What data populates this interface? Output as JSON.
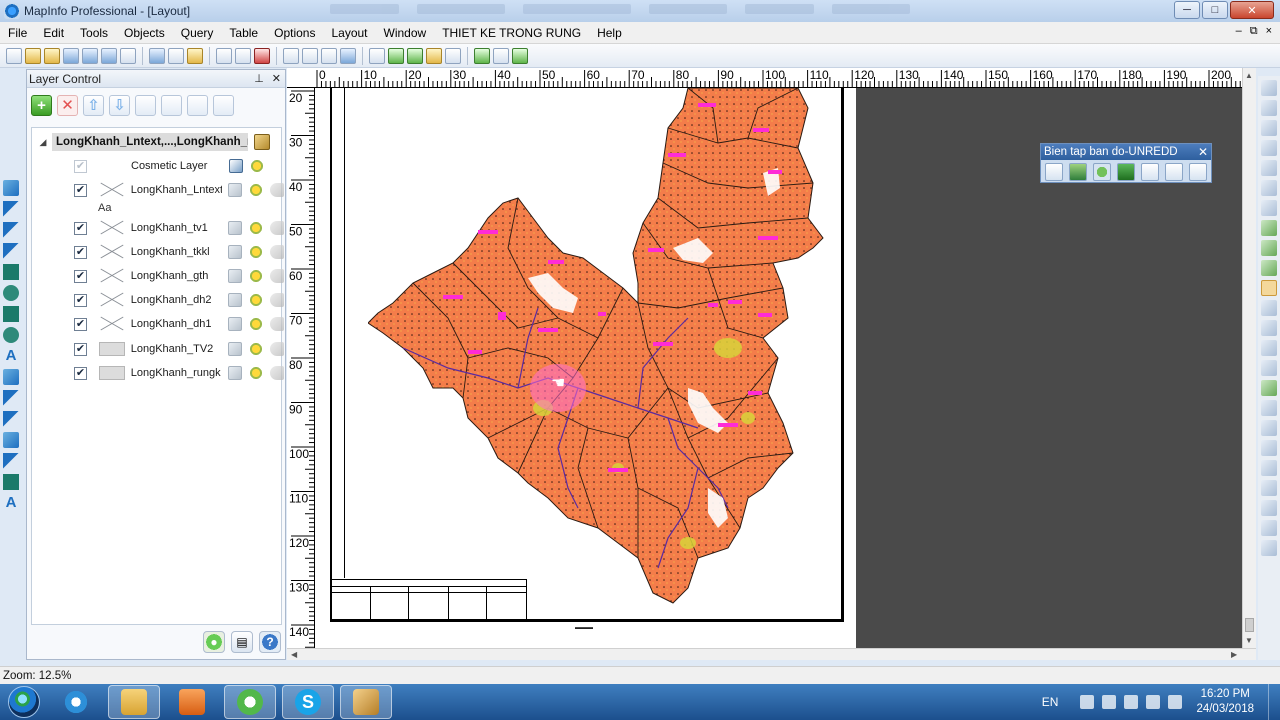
{
  "window": {
    "title": "MapInfo Professional - [Layout]",
    "controls": {
      "minimize": "─",
      "maximize": "□",
      "close": "✕"
    },
    "mdi_controls": {
      "minimize": "–",
      "restore": "⧉",
      "close": "×"
    }
  },
  "menu": [
    "File",
    "Edit",
    "Tools",
    "Objects",
    "Query",
    "Table",
    "Options",
    "Layout",
    "Window",
    "THIET KE TRONG RUNG",
    "Help"
  ],
  "layer_control": {
    "title": "Layer Control",
    "pin": "⊥",
    "close": "✕",
    "root_label": "LongKhanh_Lntext,...,LongKhanh_ru",
    "expand_glyph": "◢",
    "layers": [
      {
        "name": "Cosmetic Layer",
        "checked": true,
        "dimmed": true,
        "symbol": "none"
      },
      {
        "name": "LongKhanh_Lntext",
        "checked": true,
        "dimmed": false,
        "symbol": "x",
        "sub": "Aa"
      },
      {
        "name": "LongKhanh_tv1",
        "checked": true,
        "dimmed": false,
        "symbol": "x"
      },
      {
        "name": "LongKhanh_tkkl",
        "checked": true,
        "dimmed": false,
        "symbol": "x"
      },
      {
        "name": "LongKhanh_gth",
        "checked": true,
        "dimmed": false,
        "symbol": "x"
      },
      {
        "name": "LongKhanh_dh2",
        "checked": true,
        "dimmed": false,
        "symbol": "x"
      },
      {
        "name": "LongKhanh_dh1",
        "checked": true,
        "dimmed": false,
        "symbol": "x"
      },
      {
        "name": "LongKhanh_TV2",
        "checked": true,
        "dimmed": false,
        "symbol": "box"
      },
      {
        "name": "LongKhanh_rungk",
        "checked": true,
        "dimmed": false,
        "symbol": "box"
      }
    ],
    "check_glyph": "✔",
    "tools": {
      "add": "+",
      "remove": "✕"
    },
    "bottom": {
      "ok": "●",
      "options": "▤",
      "help": "?"
    }
  },
  "ruler": {
    "top": [
      "0",
      "10",
      "20",
      "30",
      "40",
      "50",
      "60",
      "70",
      "80",
      "90",
      "100",
      "110",
      "120",
      "130",
      "140",
      "150",
      "160",
      "170",
      "180",
      "190",
      "200"
    ],
    "left": [
      "20",
      "30",
      "40",
      "50",
      "60",
      "70",
      "80",
      "90",
      "100",
      "110",
      "120",
      "130",
      "140"
    ]
  },
  "floating_toolbar": {
    "title": "Bien tap ban do-UNREDD",
    "close": "✕"
  },
  "status": {
    "zoom": "Zoom: 12.5%"
  },
  "taskbar": {
    "apps": [
      "internet-explorer",
      "file-explorer",
      "media-player",
      "green-app",
      "skype",
      "mapinfo"
    ],
    "skype_glyph": "S",
    "language": "EN",
    "time": "16:20 PM",
    "date": "24/03/2018"
  },
  "colors": {
    "map_fill": "#f47d4a",
    "map_boundary": "#2a1a12",
    "river": "#5a2aa0",
    "label_pink": "#ff2bd6",
    "canvas_gray": "#4a4a4a",
    "titlebar": "#b8cfea"
  }
}
